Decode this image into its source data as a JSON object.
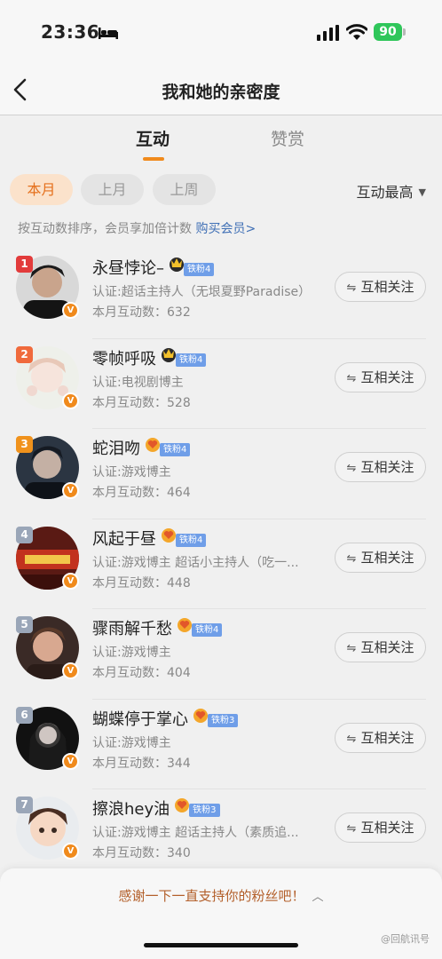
{
  "status_bar": {
    "time": "23:36",
    "battery": "90"
  },
  "nav": {
    "title": "我和她的亲密度"
  },
  "tabs": [
    {
      "label": "互动",
      "active": true
    },
    {
      "label": "赞赏",
      "active": false
    }
  ],
  "filters": [
    {
      "label": "本月",
      "active": true
    },
    {
      "label": "上月"
    },
    {
      "label": "上周"
    }
  ],
  "sort_label": "互动最高",
  "hint": {
    "text": "按互动数排序，会员享加倍计数 ",
    "link": "购买会员>"
  },
  "follow_label": "互相关注",
  "fans": [
    {
      "rank": "1",
      "name": "永昼悖论–",
      "fan_level": "铁粉4",
      "cert": "认证:超话主持人（无垠夏野Paradise）",
      "count": "本月互动数：632"
    },
    {
      "rank": "2",
      "name": "零帧呼吸",
      "fan_level": "铁粉4",
      "cert": "认证:电视剧博主",
      "count": "本月互动数：528"
    },
    {
      "rank": "3",
      "name": "蛇泪吻",
      "fan_level": "铁粉4",
      "cert": "认证:游戏博主",
      "count": "本月互动数：464"
    },
    {
      "rank": "4",
      "name": "风起于昼",
      "fan_level": "铁粉4",
      "cert": "认证:游戏博主 超话小主持人（吃一...",
      "count": "本月互动数：448"
    },
    {
      "rank": "5",
      "name": "骤雨解千愁",
      "fan_level": "铁粉4",
      "cert": "认证:游戏博主",
      "count": "本月互动数：404"
    },
    {
      "rank": "6",
      "name": "蝴蝶停于掌心",
      "fan_level": "铁粉3",
      "cert": "认证:游戏博主",
      "count": "本月互动数：344"
    },
    {
      "rank": "7",
      "name": "擦浪hey油",
      "fan_level": "铁粉3",
      "cert": "认证:游戏博主 超话主持人（素质追...",
      "count": "本月互动数：340"
    }
  ],
  "bottom": {
    "thanks": "感谢一下一直支持你的粉丝吧！",
    "watermark": "@回航讯号"
  },
  "colors": {
    "accent": "#f08a1c",
    "rank1": "#e23b3b",
    "rank2": "#f06a3c",
    "rank3": "#f0921c",
    "rank_other": "#9aa6b8",
    "fan_tag": "#6f9ee8"
  }
}
